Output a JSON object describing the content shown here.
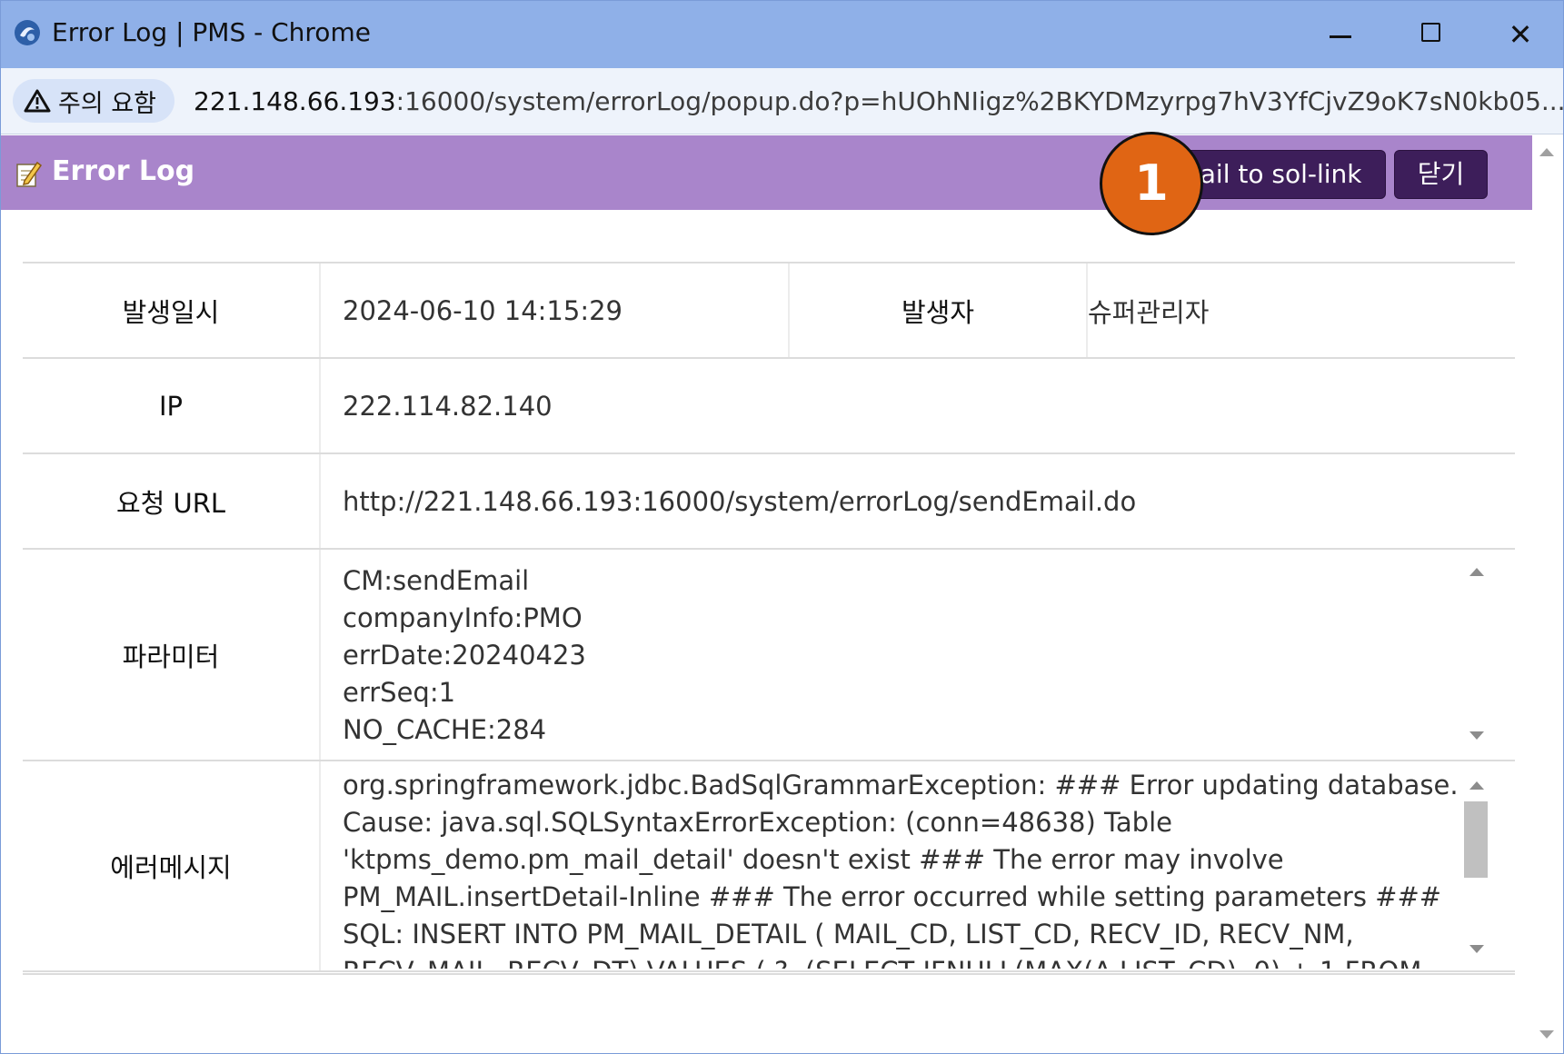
{
  "window": {
    "title": "Error Log | PMS - Chrome",
    "minimize_icon": "minimize-icon",
    "maximize_icon": "maximize-icon",
    "close_glyph": "✕"
  },
  "address_bar": {
    "warning_label": "주의 요함",
    "url_host": "221.148.66.193",
    "url_rest": ":16000/system/errorLog/popup.do?p=hUOhNIigz%2BKYDMzyrpg7hV3YfCjvZ9oK7sN0kb05..."
  },
  "header": {
    "title": "Error Log",
    "email_button": "mail to sol-link",
    "close_button": "닫기",
    "annotation_badge": "1",
    "bg_color": "#a985cb",
    "button_color": "#3d1e5a",
    "badge_color": "#e06514"
  },
  "details": {
    "occurred_at_label": "발생일시",
    "occurred_at_value": "2024-06-10 14:15:29",
    "reporter_label": "발생자",
    "reporter_value": "슈퍼관리자",
    "ip_label": "IP",
    "ip_value": "222.114.82.140",
    "request_url_label": "요청 URL",
    "request_url_value": "http://221.148.66.193:16000/system/errorLog/sendEmail.do",
    "params_label": "파라미터",
    "params": [
      "CM:sendEmail",
      "companyInfo:PMO",
      "errDate:20240423",
      "errSeq:1",
      "NO_CACHE:284"
    ],
    "error_label": "에러메시지",
    "error_message": "org.springframework.jdbc.BadSqlGrammarException: ### Error updating database. Cause: java.sql.SQLSyntaxErrorException: (conn=48638) Table 'ktpms_demo.pm_mail_detail' doesn't exist ### The error may involve PM_MAIL.insertDetail-Inline ### The error occurred while setting parameters ### SQL: INSERT INTO PM_MAIL_DETAIL ( MAIL_CD, LIST_CD, RECV_ID, RECV_NM, RECV_MAIL, RECV_DT) VALUES ( ?, (SELECT IFNULL(MAX(A.LIST_CD), 0) + 1 FROM PM_MAIL_DETAIL A WHERE A.MAIL_CD = ? ), ?, ?, ?"
  }
}
